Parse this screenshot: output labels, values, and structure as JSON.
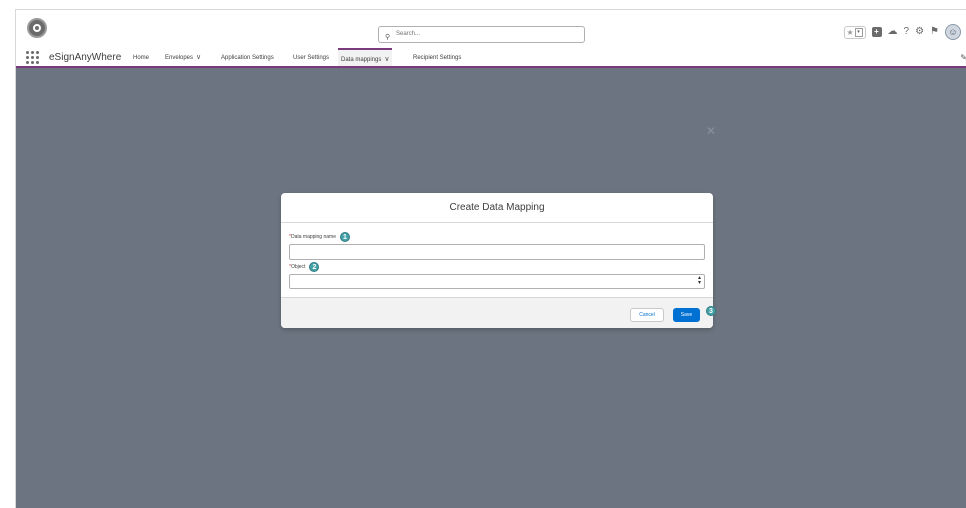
{
  "header": {
    "search_placeholder": "Search...",
    "icons": [
      "favorites-star-icon",
      "favorites-dropdown-icon",
      "plus-icon",
      "cloud-icon",
      "help-icon",
      "gear-icon",
      "bell-icon",
      "avatar"
    ]
  },
  "nav": {
    "app_name": "eSignAnyWhere",
    "items": [
      {
        "label": "Home"
      },
      {
        "label": "Envelopes",
        "has_menu": true
      },
      {
        "label": "Application Settings"
      },
      {
        "label": "User Settings"
      },
      {
        "label": "Data mappings",
        "has_menu": true,
        "active": true
      },
      {
        "label": "Recipient Settings"
      }
    ]
  },
  "modal": {
    "title": "Create Data Mapping",
    "fields": [
      {
        "label": "Data mapping name",
        "required": true,
        "value": "",
        "badge": "1"
      },
      {
        "label": "Object",
        "required": true,
        "value": "",
        "badge": "2"
      }
    ],
    "cancel_label": "Cancel",
    "save_label": "Save",
    "save_badge": "3"
  },
  "colors": {
    "overlay": "#6b7480",
    "nav_accent": "#7a3b7e",
    "primary_button": "#0070d2",
    "badge": "#46a2a8"
  }
}
